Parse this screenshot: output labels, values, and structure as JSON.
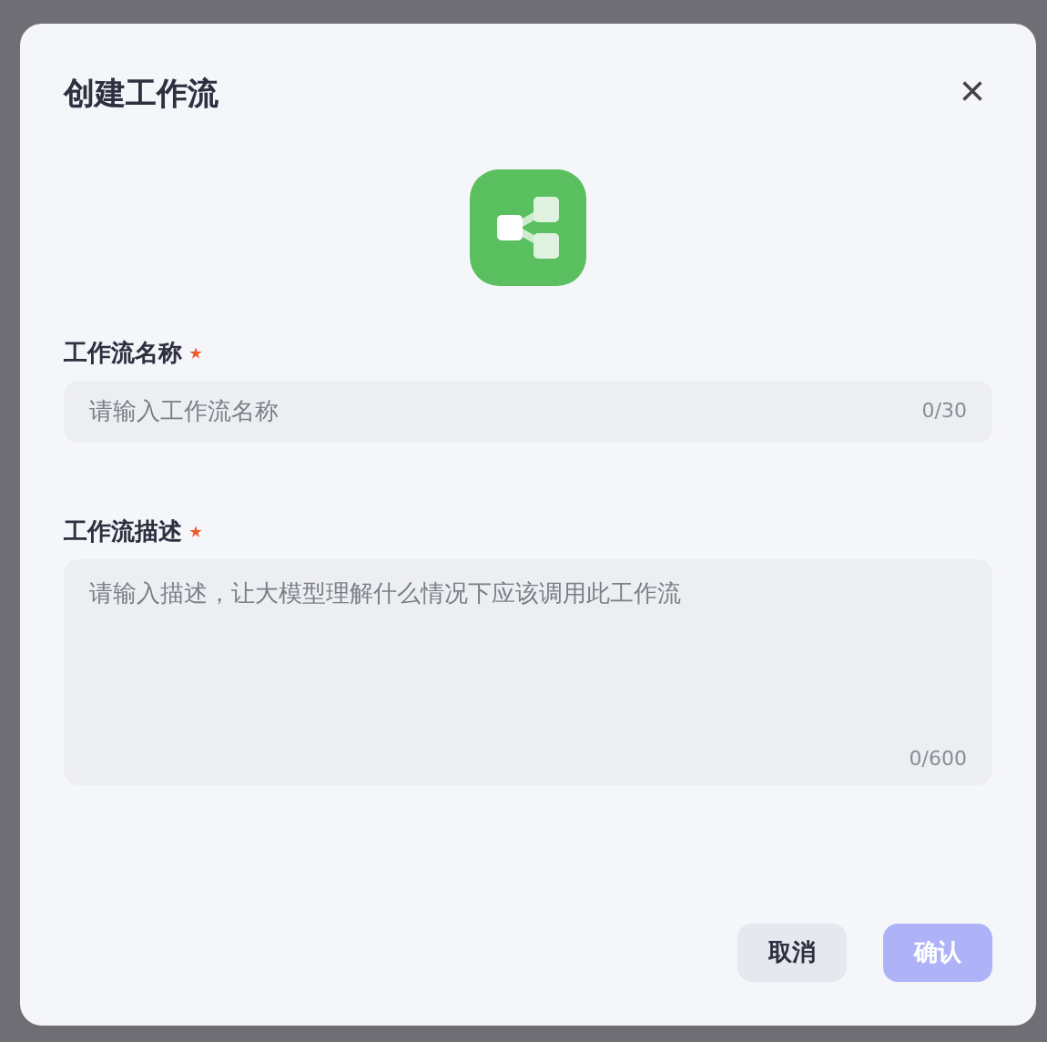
{
  "dialog": {
    "title": "创建工作流",
    "close": "×"
  },
  "fields": [
    {
      "kind": "input",
      "label": "工作流名称",
      "required": true,
      "placeholder": "请输入工作流名称",
      "counter": "0/30"
    },
    {
      "kind": "textarea",
      "label": "工作流描述",
      "required": true,
      "placeholder": "请输入描述，让大模型理解什么情况下应该调用此工作流",
      "counter": "0/600"
    }
  ],
  "buttons": [
    {
      "label": "取消",
      "kind": "secondary",
      "disabled": false
    },
    {
      "label": "确认",
      "kind": "primary",
      "disabled": true
    }
  ]
}
